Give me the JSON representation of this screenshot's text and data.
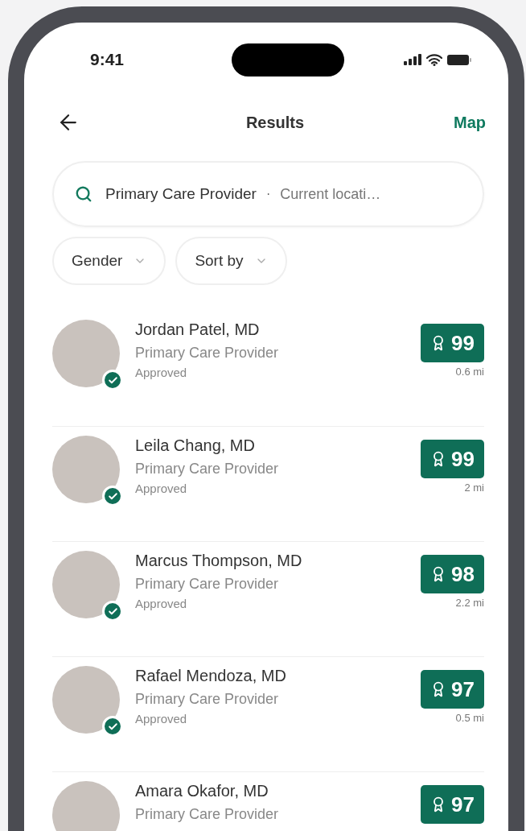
{
  "status_bar": {
    "time": "9:41"
  },
  "header": {
    "title": "Results",
    "action": "Map"
  },
  "search": {
    "query": "Primary Care Provider",
    "separator": "·",
    "location": "Current locati…"
  },
  "filters": [
    {
      "label": "Gender"
    },
    {
      "label": "Sort by"
    }
  ],
  "providers": [
    {
      "name": "Jordan Patel, MD",
      "specialty": "Primary Care Provider",
      "status": "Approved",
      "verified": true,
      "score": "99",
      "distance": "0.6 mi"
    },
    {
      "name": "Leila Chang, MD",
      "specialty": "Primary Care Provider",
      "status": "Approved",
      "verified": true,
      "score": "99",
      "distance": "2 mi"
    },
    {
      "name": "Marcus Thompson, MD",
      "specialty": "Primary Care Provider",
      "status": "Approved",
      "verified": true,
      "score": "98",
      "distance": "2.2 mi"
    },
    {
      "name": "Rafael Mendoza, MD",
      "specialty": "Primary Care Provider",
      "status": "Approved",
      "verified": true,
      "score": "97",
      "distance": "0.5 mi"
    },
    {
      "name": "Amara Okafor, MD",
      "specialty": "Primary Care Provider",
      "score": "97"
    }
  ]
}
